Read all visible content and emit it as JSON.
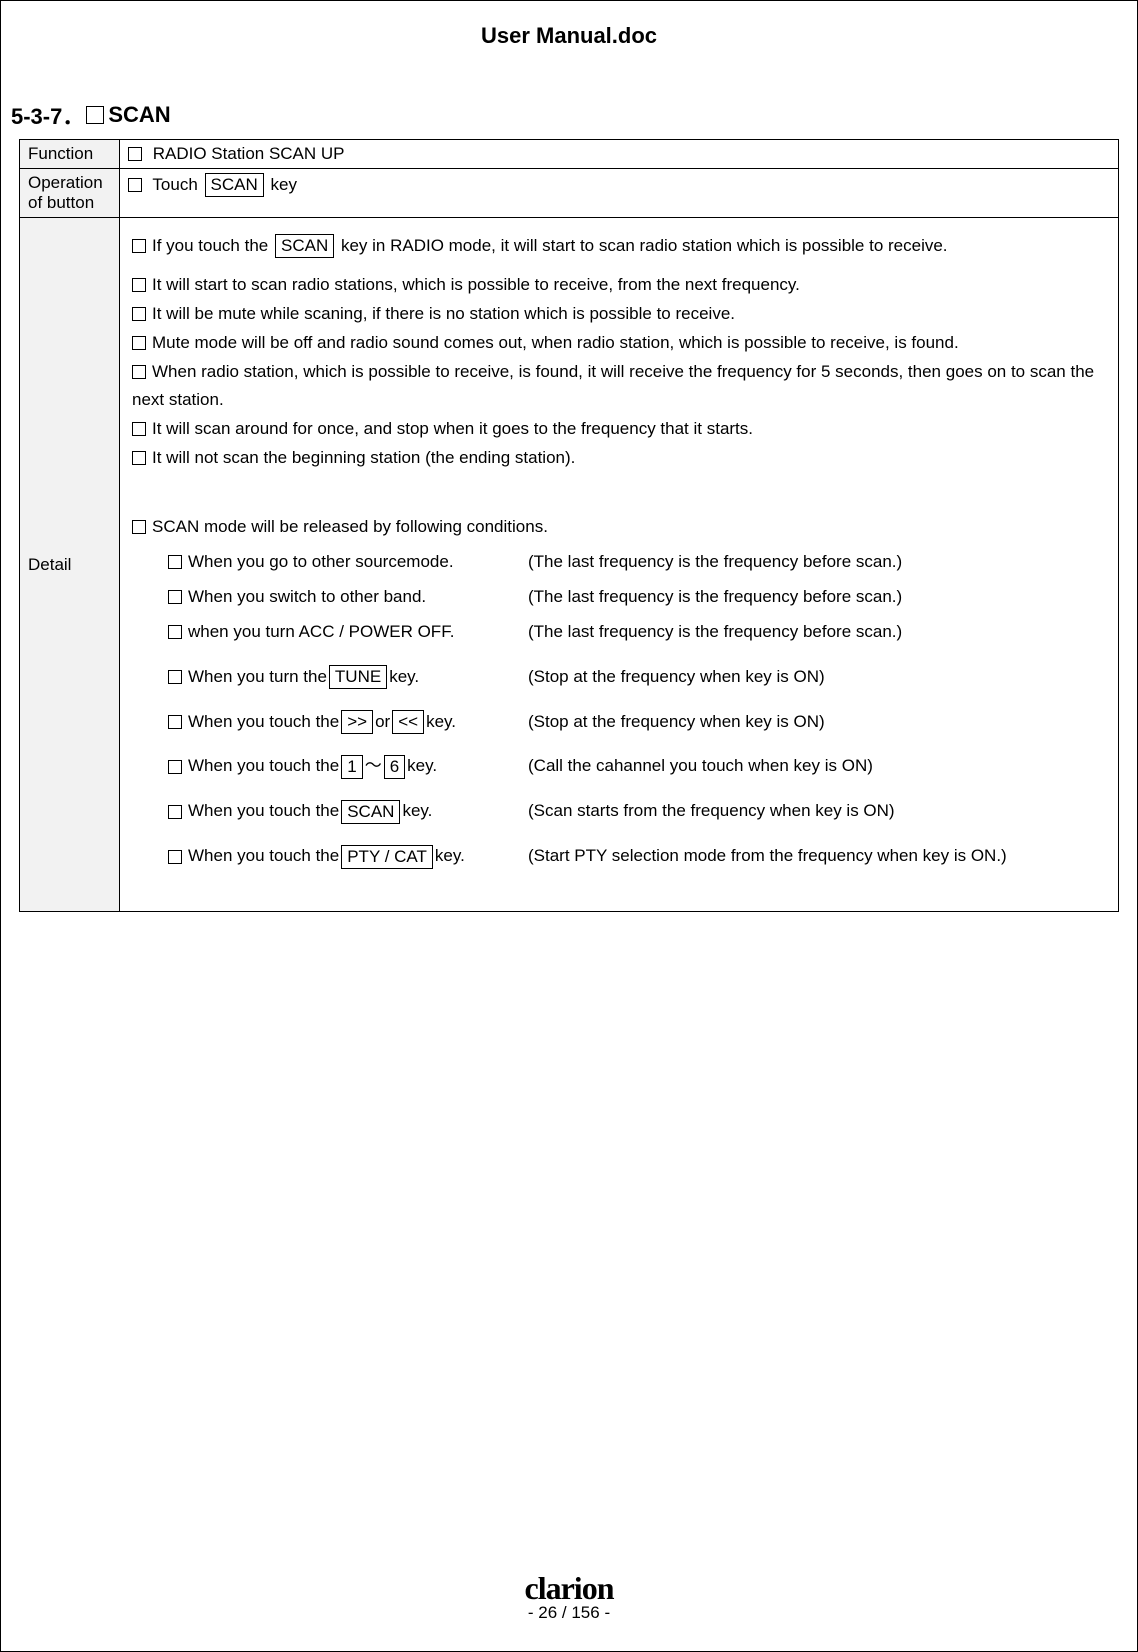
{
  "doc_title": "User Manual.doc",
  "section_number": "5-3-7．",
  "section_title": "SCAN",
  "labels": {
    "function": "Function",
    "operation": "Operation of button",
    "detail": "Detail"
  },
  "function_text": "RADIO Station SCAN  UP",
  "operation": {
    "pre": "Touch",
    "key": "SCAN",
    "post": "key"
  },
  "detail": {
    "line1_pre": "If you touch the",
    "line1_key": "SCAN",
    "line1_post": "key in RADIO mode, it will start to scan radio station which is possible to receive.",
    "bullets1": [
      "It will start to scan radio stations, which is possible to receive, from the next frequency.",
      "It will be mute while scaning, if there is no station which is possible to receive.",
      "Mute mode will be off and radio sound comes out, when radio station, which is possible to receive, is found.",
      "When radio station, which is possible to receive, is found, it will receive the frequency for 5 seconds, then goes on to scan the next station.",
      "It will scan around for once, and stop when it goes to the frequency that it starts.",
      "It will not scan the beginning station (the ending station)."
    ],
    "release_head": "SCAN mode will be released by following conditions.",
    "release": [
      {
        "left_pre": "When you go to other sourcemode.",
        "keys": [],
        "left_post": "",
        "right": "(The last frequency is the frequency before scan.)"
      },
      {
        "left_pre": "When you switch to other band.",
        "keys": [],
        "left_post": "",
        "right": "(The last frequency is the frequency before scan.)"
      },
      {
        "left_pre": "when you turn ACC / POWER  OFF.",
        "keys": [],
        "left_post": "",
        "right": "(The last frequency is the frequency before scan.)"
      },
      {
        "left_pre": "When you turn the",
        "keys": [
          "TUNE"
        ],
        "left_post": "key.",
        "right": "(Stop at the frequency when key is ON)"
      },
      {
        "left_pre": "When you touch the",
        "keys": [
          ">>",
          "or",
          "<<"
        ],
        "left_post": "key.",
        "right": "(Stop at the frequency when key is ON)"
      },
      {
        "left_pre": "When you touch the",
        "keys": [
          "1",
          "〜",
          "6"
        ],
        "left_post": "key.",
        "right": "(Call the cahannel you touch when key is ON)"
      },
      {
        "left_pre": "When you touch the",
        "keys": [
          "SCAN"
        ],
        "left_post": "key.",
        "right": "(Scan starts from the frequency when key is ON)"
      },
      {
        "left_pre": "When you touch the",
        "keys": [
          "PTY / CAT"
        ],
        "left_post": "key.",
        "right": "(Start PTY selection mode from the frequency when key is ON.)"
      }
    ]
  },
  "footer": {
    "brand": "clarion",
    "page": "- 26 / 156 -"
  }
}
